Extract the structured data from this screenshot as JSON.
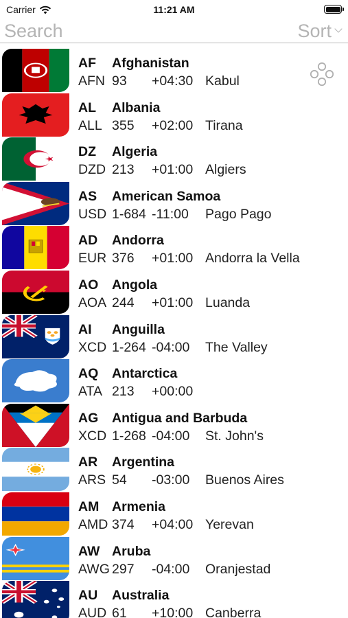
{
  "status_bar": {
    "carrier": "Carrier",
    "time": "11:21 AM"
  },
  "toolbar": {
    "search_placeholder": "Search",
    "sort_label": "Sort"
  },
  "countries": [
    {
      "code": "AF",
      "name": "Afghanistan",
      "currency": "AFN",
      "dial": "93",
      "tz": "+04:30",
      "capital": "Kabul",
      "flag": "af"
    },
    {
      "code": "AL",
      "name": "Albania",
      "currency": "ALL",
      "dial": "355",
      "tz": "+02:00",
      "capital": "Tirana",
      "flag": "al"
    },
    {
      "code": "DZ",
      "name": "Algeria",
      "currency": "DZD",
      "dial": "213",
      "tz": "+01:00",
      "capital": "Algiers",
      "flag": "dz"
    },
    {
      "code": "AS",
      "name": "American Samoa",
      "currency": "USD",
      "dial": "1-684",
      "tz": "-11:00",
      "capital": "Pago Pago",
      "flag": "as"
    },
    {
      "code": "AD",
      "name": "Andorra",
      "currency": "EUR",
      "dial": "376",
      "tz": "+01:00",
      "capital": "Andorra la Vella",
      "flag": "ad"
    },
    {
      "code": "AO",
      "name": "Angola",
      "currency": "AOA",
      "dial": "244",
      "tz": "+01:00",
      "capital": "Luanda",
      "flag": "ao"
    },
    {
      "code": "AI",
      "name": "Anguilla",
      "currency": "XCD",
      "dial": "1-264",
      "tz": "-04:00",
      "capital": "The Valley",
      "flag": "ai"
    },
    {
      "code": "AQ",
      "name": "Antarctica",
      "currency": "ATA",
      "dial": "213",
      "tz": "+00:00",
      "capital": "",
      "flag": "aq"
    },
    {
      "code": "AG",
      "name": "Antigua and Barbuda",
      "currency": "XCD",
      "dial": "1-268",
      "tz": "-04:00",
      "capital": "St. John's",
      "flag": "ag"
    },
    {
      "code": "AR",
      "name": "Argentina",
      "currency": "ARS",
      "dial": "54",
      "tz": "-03:00",
      "capital": "Buenos Aires",
      "flag": "ar"
    },
    {
      "code": "AM",
      "name": "Armenia",
      "currency": "AMD",
      "dial": "374",
      "tz": "+04:00",
      "capital": "Yerevan",
      "flag": "am"
    },
    {
      "code": "AW",
      "name": "Aruba",
      "currency": "AWG",
      "dial": "297",
      "tz": "-04:00",
      "capital": "Oranjestad",
      "flag": "aw"
    },
    {
      "code": "AU",
      "name": "Australia",
      "currency": "AUD",
      "dial": "61",
      "tz": "+10:00",
      "capital": "Canberra",
      "flag": "au"
    }
  ],
  "colors": {
    "placeholder": "#b4b4b4",
    "divider": "#b9b9b9"
  }
}
